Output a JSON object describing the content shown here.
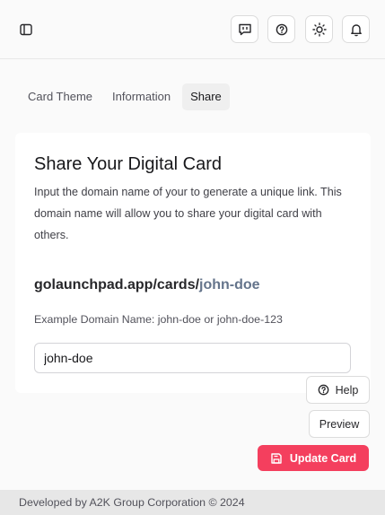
{
  "header": {
    "icons": {
      "sidebar_toggle": "sidebar-icon",
      "feedback": "message-alert-icon",
      "help": "help-circle-icon",
      "theme": "sun-icon",
      "notifications": "bell-icon"
    }
  },
  "tabs": [
    {
      "label": "Card Theme",
      "active": false
    },
    {
      "label": "Information",
      "active": false
    },
    {
      "label": "Share",
      "active": true
    }
  ],
  "share": {
    "title": "Share Your Digital Card",
    "description": "Input the domain name of your to generate a unique link. This domain name will allow you to share your digital card with others.",
    "url_prefix": "golaunchpad.app/cards/",
    "url_slug": "john-doe",
    "example": "Example Domain Name: john-doe or john-doe-123",
    "input_value": "john-doe"
  },
  "actions": {
    "help_label": "Help",
    "preview_label": "Preview",
    "update_label": "Update Card"
  },
  "footer": {
    "text": "Developed by A2K Group Corporation © 2024"
  },
  "colors": {
    "accent": "#f43f5e",
    "background": "#fafafa",
    "footer_bg": "#e7e7e7"
  }
}
